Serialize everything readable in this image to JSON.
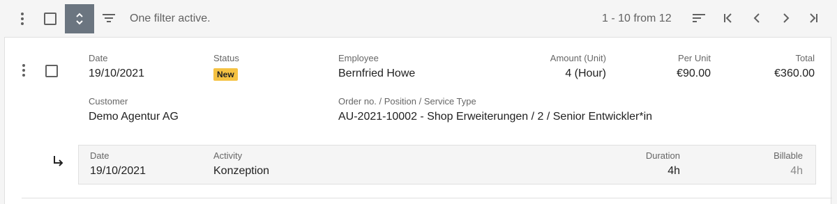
{
  "toolbar": {
    "filter_status": "One filter active.",
    "pagination_text": "1 - 10 from 12",
    "icons": [
      "more-vert-icon",
      "select-all-checkbox",
      "expand-collapse-icon",
      "filter-icon",
      "sort-icon",
      "first-page-icon",
      "prev-page-icon",
      "next-page-icon",
      "last-page-icon"
    ]
  },
  "row": {
    "date_label": "Date",
    "date_value": "19/10/2021",
    "status_label": "Status",
    "status_value": "New",
    "employee_label": "Employee",
    "employee_value": "Bernfried Howe",
    "amount_label": "Amount (Unit)",
    "amount_value": "4 (Hour)",
    "per_unit_label": "Per Unit",
    "per_unit_value": "€90.00",
    "total_label": "Total",
    "total_value": "€360.00",
    "customer_label": "Customer",
    "customer_value": "Demo Agentur AG",
    "order_label": "Order no. / Position / Service Type",
    "order_value": "AU-2021-10002 - Shop Erweiterungen / 2 / Senior Entwickler*in"
  },
  "subrow": {
    "date_label": "Date",
    "date_value": "19/10/2021",
    "activity_label": "Activity",
    "activity_value": "Konzeption",
    "duration_label": "Duration",
    "duration_value": "4h",
    "billable_label": "Billable",
    "billable_value": "4h"
  },
  "colors": {
    "status_badge": "#f5c242",
    "expand_button": "#6b7580"
  }
}
